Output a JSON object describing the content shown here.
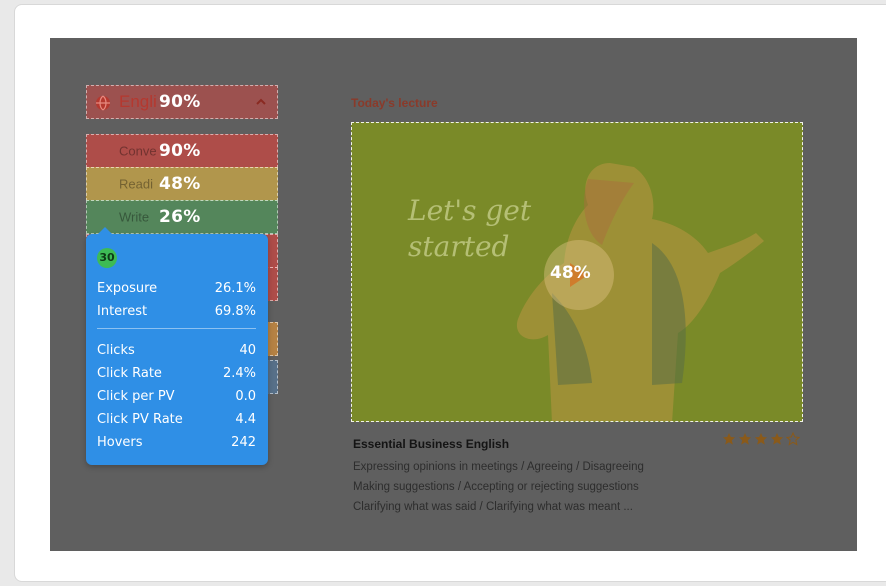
{
  "sidebar": {
    "header": {
      "label_partial": "Engli",
      "percent": "90%"
    },
    "items": [
      {
        "label_partial": "Conve",
        "percent": "90%"
      },
      {
        "label_partial": "Readi",
        "percent": "48%"
      },
      {
        "label_partial": "Write",
        "percent": "26%"
      }
    ]
  },
  "tooltip": {
    "badge": "30",
    "group1": [
      {
        "label": "Exposure",
        "value": "26.1%"
      },
      {
        "label": "Interest",
        "value": "69.8%"
      }
    ],
    "group2": [
      {
        "label": "Clicks",
        "value": "40"
      },
      {
        "label": "Click Rate",
        "value": "2.4%"
      },
      {
        "label": "Click per PV",
        "value": "0.0"
      },
      {
        "label": "Click PV Rate",
        "value": "4.4"
      },
      {
        "label": "Hovers",
        "value": "242"
      }
    ]
  },
  "main": {
    "section_label": "Today's lecture",
    "video": {
      "overlay_text_line1": "Let's get",
      "overlay_text_line2": "started",
      "percent": "48%"
    },
    "course": {
      "title": "Essential Business English",
      "rating": 4,
      "rating_max": 5,
      "description": [
        "Expressing opinions in meetings / Agreeing / Disagreeing",
        "Making suggestions / Accepting or rejecting suggestions",
        "Clarifying what was said / Clarifying what was meant ..."
      ]
    }
  },
  "colors": {
    "overlay_bg": "#5f5f5f",
    "tooltip_bg": "#2f8fe6",
    "heat_red": "#cd4641",
    "heat_yellow": "#c8a546",
    "heat_green": "#50965a",
    "video_overlay": "#7a8a28",
    "star": "#8a5a1a"
  }
}
